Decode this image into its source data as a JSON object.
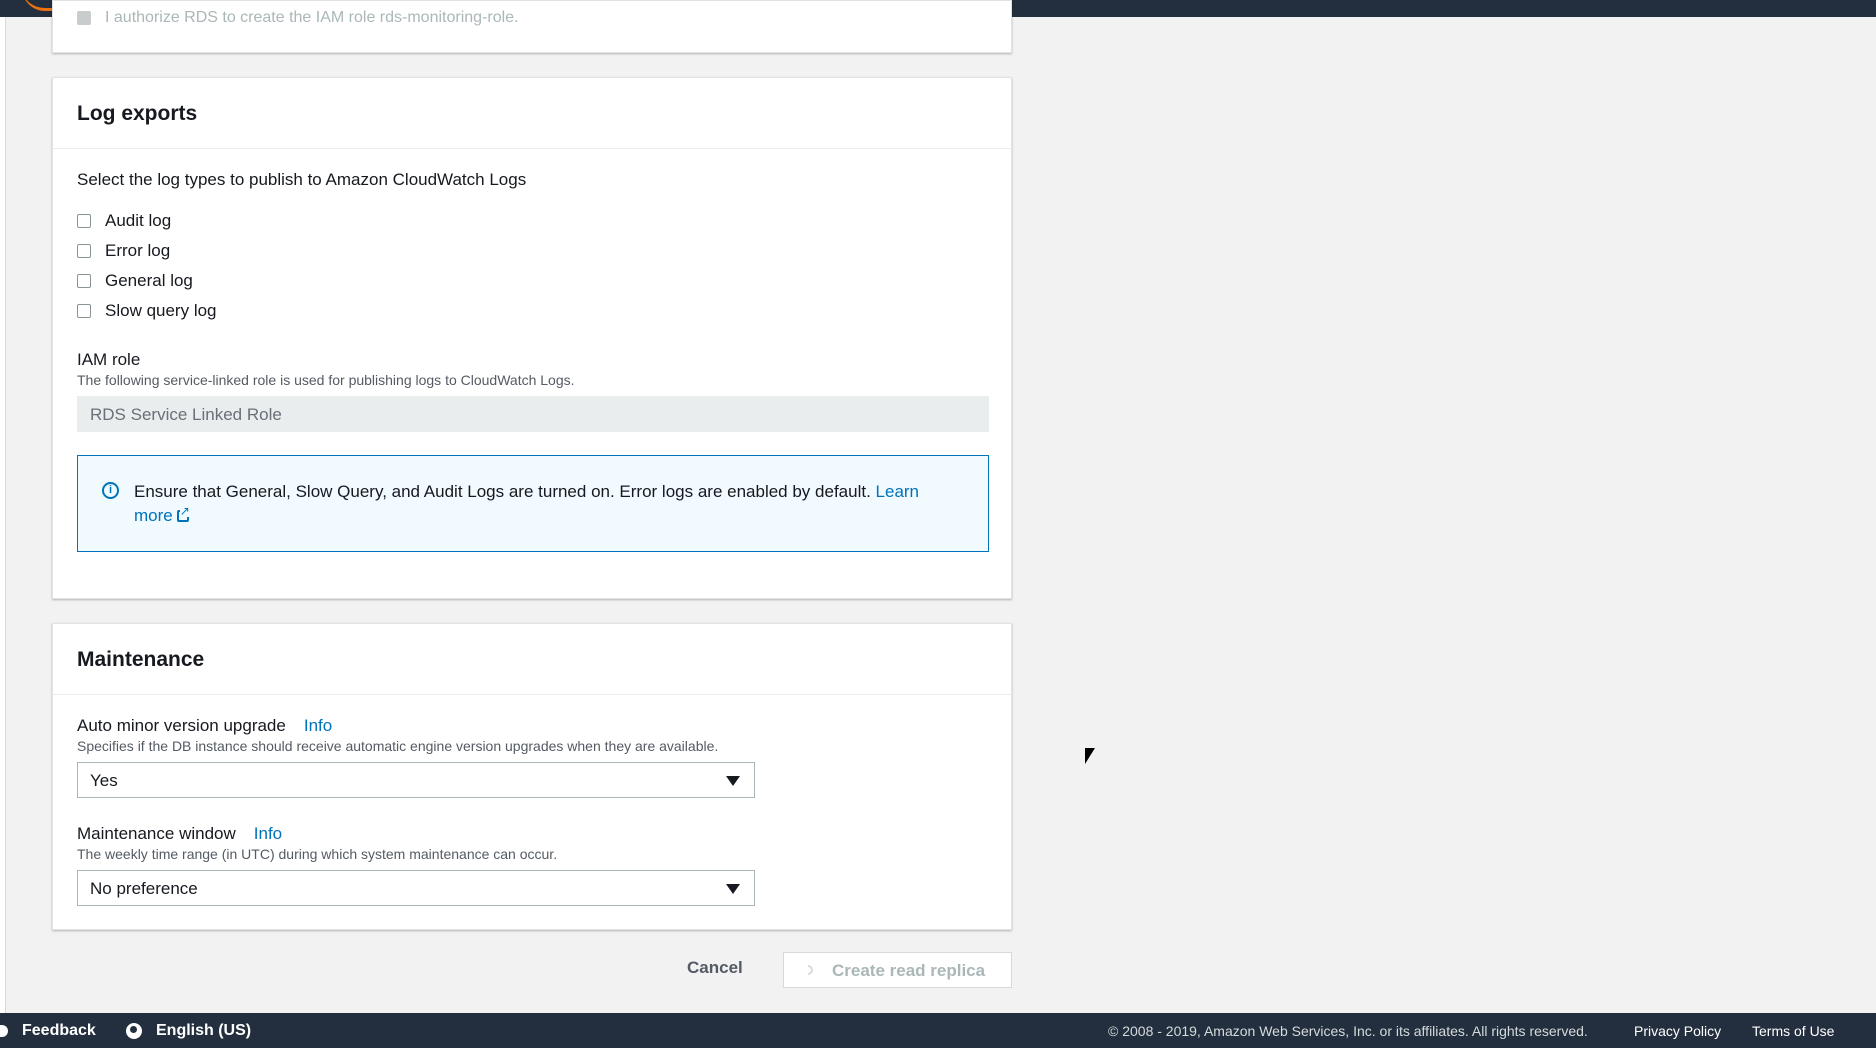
{
  "top_panel": {
    "faded_text": "I authorize RDS to create the IAM role rds-monitoring-role."
  },
  "log_exports": {
    "title": "Log exports",
    "description": "Select the log types to publish to Amazon CloudWatch Logs",
    "checkboxes": [
      {
        "label": "Audit log",
        "checked": false
      },
      {
        "label": "Error log",
        "checked": false
      },
      {
        "label": "General log",
        "checked": false
      },
      {
        "label": "Slow query log",
        "checked": false
      }
    ],
    "iam_role": {
      "label": "IAM role",
      "hint": "The following service-linked role is used for publishing logs to CloudWatch Logs.",
      "value": "RDS Service Linked Role"
    },
    "info_box": {
      "text": "Ensure that General, Slow Query, and Audit Logs are turned on. Error logs are enabled by default.",
      "link": "Learn more"
    }
  },
  "maintenance": {
    "title": "Maintenance",
    "auto_minor": {
      "label": "Auto minor version upgrade",
      "info": "Info",
      "hint": "Specifies if the DB instance should receive automatic engine version upgrades when they are available.",
      "value": "Yes"
    },
    "window": {
      "label": "Maintenance window",
      "info": "Info",
      "hint": "The weekly time range (in UTC) during which system maintenance can occur.",
      "value": "No preference"
    }
  },
  "actions": {
    "cancel": "Cancel",
    "create": "Create read replica"
  },
  "footer": {
    "feedback": "Feedback",
    "language": "English (US)",
    "copyright": "© 2008 - 2019, Amazon Web Services, Inc. or its affiliates. All rights reserved.",
    "privacy": "Privacy Policy",
    "terms": "Terms of Use"
  },
  "colors": {
    "link": "#0073bb",
    "nav_bg": "#232f3e",
    "page_bg": "#f2f2f2"
  }
}
